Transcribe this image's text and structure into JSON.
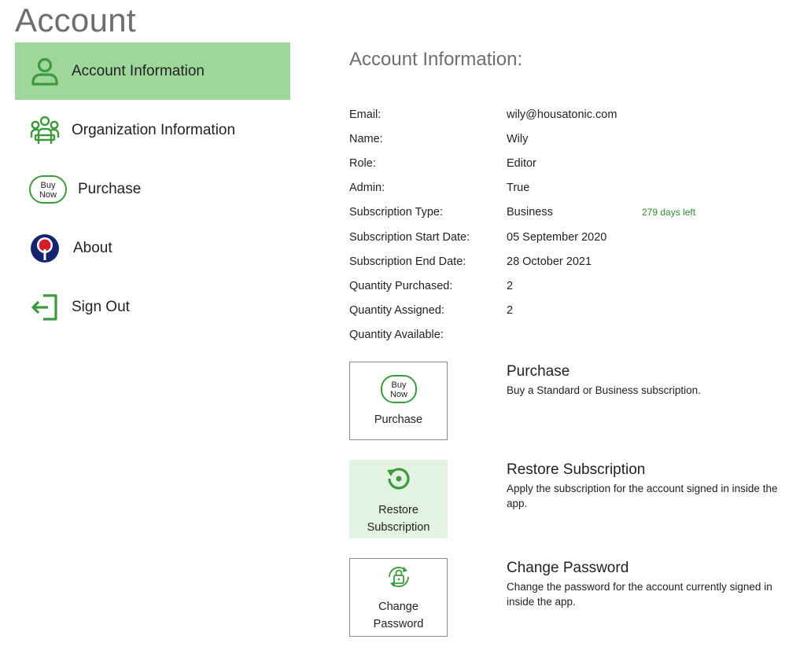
{
  "page": {
    "title": "Account"
  },
  "sidebar": {
    "items": [
      {
        "label": "Account Information",
        "icon": "user-icon",
        "active": true
      },
      {
        "label": "Organization Information",
        "icon": "organization-icon",
        "active": false
      },
      {
        "label": "Purchase",
        "icon": "buy-now-icon",
        "active": false
      },
      {
        "label": "About",
        "icon": "about-logo-icon",
        "active": false
      },
      {
        "label": "Sign Out",
        "icon": "sign-out-icon",
        "active": false
      }
    ]
  },
  "main": {
    "heading": "Account Information:",
    "fields": [
      {
        "label": "Email:",
        "value": "wily@housatonic.com",
        "extra": ""
      },
      {
        "label": "Name:",
        "value": "Wily",
        "extra": ""
      },
      {
        "label": "Role:",
        "value": "Editor",
        "extra": ""
      },
      {
        "label": "Admin:",
        "value": "True",
        "extra": ""
      },
      {
        "label": "Subscription Type:",
        "value": "Business",
        "extra": "279 days left"
      },
      {
        "label": "Subscription Start Date:",
        "value": "05 September 2020",
        "extra": ""
      },
      {
        "label": "Subscription End Date:",
        "value": "28 October 2021",
        "extra": ""
      },
      {
        "label": "Quantity Purchased:",
        "value": "2",
        "extra": ""
      },
      {
        "label": "Quantity Assigned:",
        "value": "2",
        "extra": ""
      },
      {
        "label": "Quantity Available:",
        "value": "",
        "extra": ""
      }
    ],
    "actions": [
      {
        "tile_label_line1": "Purchase",
        "tile_label_line2": "",
        "icon_text_line1": "Buy",
        "icon_text_line2": "Now",
        "title": "Purchase",
        "description": "Buy a Standard or Business subscription."
      },
      {
        "tile_label_line1": "Restore",
        "tile_label_line2": "Subscription",
        "title": "Restore Subscription",
        "description": "Apply the subscription for the account signed in inside the app."
      },
      {
        "tile_label_line1": "Change",
        "tile_label_line2": "Password",
        "title": "Change Password",
        "description": "Change the password for the account currently signed in inside the app."
      }
    ]
  },
  "colors": {
    "accent_green": "#3c9a3c",
    "active_bg": "#9fd69b",
    "highlight_tile_bg": "#e3f3e1",
    "days_left": "#2e8b2e"
  }
}
